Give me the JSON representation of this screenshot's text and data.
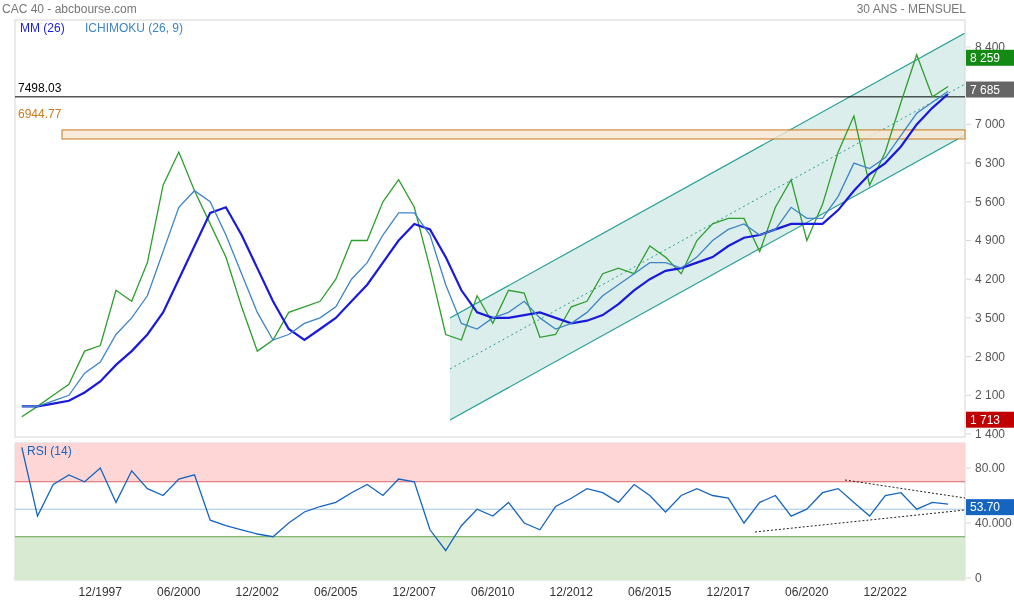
{
  "header": {
    "title": "CAC 40 - abcbourse.com",
    "period": "30 ANS - MENSUEL"
  },
  "price_chart": {
    "chart_data": {
      "type": "line",
      "categories": [
        null,
        null,
        null,
        null,
        null,
        null,
        null,
        null,
        null,
        null,
        null,
        null,
        null,
        null,
        null,
        null,
        null,
        null,
        null,
        null,
        null,
        null,
        null,
        null,
        null,
        null,
        null,
        null,
        null,
        null,
        null,
        null,
        null,
        null,
        null,
        null,
        null,
        null,
        null,
        null,
        null,
        null,
        null,
        null,
        null,
        null,
        null,
        null,
        null,
        null,
        null,
        null,
        null,
        null,
        null,
        null,
        null,
        null,
        null,
        null
      ],
      "series": [
        {
          "color": "#2e9e2e",
          "values": [
            1713,
            1900,
            2100,
            2300,
            2900,
            3000,
            4000,
            3800,
            4500,
            5900,
            6500,
            5800,
            5200,
            4600,
            3700,
            2900,
            3100,
            3600,
            3700,
            3800,
            4200,
            4900,
            4900,
            5600,
            6000,
            5500,
            4400,
            3200,
            3100,
            3900,
            3400,
            4000,
            3950,
            3150,
            3200,
            3700,
            3800,
            4300,
            4400,
            4300,
            4800,
            4600,
            4300,
            4900,
            5200,
            5300,
            5300,
            4700,
            5500,
            6000,
            4900,
            5550,
            6500,
            7150,
            5900,
            6500,
            7400,
            8259,
            7500,
            7685
          ]
        },
        {
          "name": "MM (26)",
          "color": "#1a1adc",
          "values": [
            1900,
            1900,
            1950,
            2000,
            2150,
            2350,
            2650,
            2900,
            3200,
            3600,
            4200,
            4800,
            5400,
            5500,
            5000,
            4400,
            3800,
            3300,
            3100,
            3300,
            3500,
            3800,
            4100,
            4500,
            4900,
            5200,
            5100,
            4600,
            4000,
            3600,
            3500,
            3500,
            3550,
            3600,
            3500,
            3400,
            3450,
            3550,
            3750,
            4000,
            4200,
            4350,
            4400,
            4500,
            4600,
            4800,
            4950,
            5000,
            5100,
            5200,
            5200,
            5200,
            5450,
            5800,
            6100,
            6300,
            6600,
            7000,
            7300,
            7550
          ]
        },
        {
          "name": "ICHIMOKU (26, 9)",
          "color": "#3d85c6",
          "values": [
            1900,
            1900,
            2000,
            2100,
            2500,
            2700,
            3200,
            3500,
            3900,
            4700,
            5500,
            5800,
            5600,
            5000,
            4300,
            3600,
            3100,
            3200,
            3400,
            3500,
            3700,
            4200,
            4500,
            5000,
            5400,
            5400,
            5000,
            4100,
            3400,
            3300,
            3500,
            3600,
            3800,
            3500,
            3300,
            3400,
            3600,
            3900,
            4100,
            4300,
            4500,
            4500,
            4400,
            4600,
            4900,
            5100,
            5200,
            5000,
            5100,
            5500,
            5300,
            5300,
            5700,
            6300,
            6200,
            6400,
            6800,
            7200,
            7400,
            7600
          ]
        }
      ],
      "ylim": [
        1346,
        8888
      ],
      "yticks": [
        {
          "value": 8400,
          "label": "8 400"
        },
        {
          "value": 7000,
          "label": "7 000"
        },
        {
          "value": 6300,
          "label": "6 300"
        },
        {
          "value": 5600,
          "label": "5 600"
        },
        {
          "value": 4900,
          "label": "4 900"
        },
        {
          "value": 4200,
          "label": "4 200"
        },
        {
          "value": 3500,
          "label": "3 500"
        },
        {
          "value": 2800,
          "label": "2 800"
        },
        {
          "value": 2100,
          "label": "2 100"
        },
        {
          "value": 1400,
          "label": "1 400"
        }
      ],
      "ref_lines": [
        {
          "axis": "y",
          "value": 7498.03,
          "label": "7498.03",
          "color": "#000000"
        }
      ],
      "bands": [
        {
          "axis": "y",
          "from": 6736,
          "to": 6900,
          "label": "6944.77",
          "color": "#c87a1e"
        }
      ]
    },
    "value_tags": [
      {
        "kind": "high",
        "label": "8 259",
        "color": "#138a13"
      },
      {
        "kind": "last",
        "label": "7 685",
        "color": "#666666"
      },
      {
        "kind": "low",
        "label": "1 713",
        "color": "#c00000"
      }
    ]
  },
  "rsi_chart": {
    "chart_data": {
      "type": "line",
      "title": "RSI (14)",
      "categories": [
        null,
        null,
        null,
        null,
        null,
        "12/1997",
        null,
        null,
        null,
        null,
        "06/2000",
        null,
        null,
        null,
        null,
        "12/2002",
        null,
        null,
        null,
        null,
        "06/2005",
        null,
        null,
        null,
        null,
        "12/2007",
        null,
        null,
        null,
        null,
        "06/2010",
        null,
        null,
        null,
        null,
        "12/2012",
        null,
        null,
        null,
        null,
        "06/2015",
        null,
        null,
        null,
        null,
        "12/2017",
        null,
        null,
        null,
        null,
        "06/2020",
        null,
        null,
        null,
        null,
        "12/2022",
        null,
        null,
        null,
        null
      ],
      "series": [
        {
          "color": "#1565c0",
          "values": [
            95,
            45,
            68,
            75,
            70,
            80,
            55,
            78,
            65,
            60,
            72,
            75,
            42,
            38,
            35,
            32,
            30,
            40,
            48,
            52,
            55,
            62,
            68,
            60,
            72,
            70,
            35,
            20,
            38,
            50,
            45,
            55,
            40,
            35,
            52,
            58,
            65,
            62,
            55,
            68,
            60,
            48,
            60,
            65,
            60,
            58,
            40,
            55,
            60,
            45,
            50,
            62,
            65,
            55,
            45,
            60,
            62,
            50,
            55,
            53.7
          ]
        }
      ],
      "ylim": [
        -1.5,
        98.2
      ],
      "yticks": [
        {
          "value": 80,
          "label": "80.00"
        },
        {
          "value": 40,
          "label": "40.000"
        },
        {
          "value": 0,
          "label": "0"
        }
      ],
      "ref_lines": [
        {
          "axis": "y",
          "value": 70,
          "color": "#e06666"
        },
        {
          "axis": "y",
          "value": 50,
          "color": "#9fc5e8"
        },
        {
          "axis": "y",
          "value": 30,
          "color": "#6aa84f"
        }
      ],
      "bands": [
        {
          "axis": "y",
          "from": 70,
          "to": 98.2,
          "color": "#ffd6d6"
        },
        {
          "axis": "y",
          "from": -1.5,
          "to": 30,
          "color": "#d9ead3"
        }
      ]
    },
    "value_tags": [
      {
        "kind": "last",
        "label": "53.70",
        "color": "#1565c0"
      }
    ]
  }
}
